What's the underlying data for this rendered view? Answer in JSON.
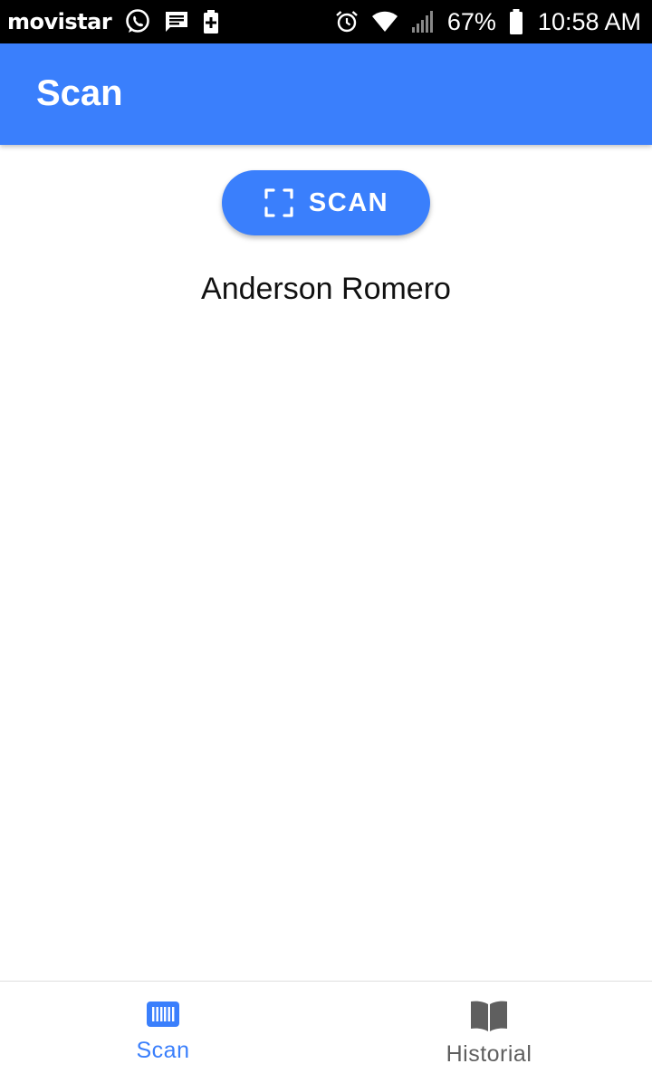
{
  "status_bar": {
    "carrier": "movistar",
    "battery_percent": "67%",
    "time": "10:58 AM",
    "icons": [
      "whatsapp-icon",
      "message-icon",
      "battery-saver-icon",
      "alarm-icon",
      "wifi-icon",
      "signal-icon",
      "battery-icon"
    ]
  },
  "app_bar": {
    "title": "Scan"
  },
  "main": {
    "scan_button_label": "SCAN",
    "scan_button_icon": "scan-frame-icon",
    "result_text": "Anderson Romero"
  },
  "bottom_nav": {
    "items": [
      {
        "label": "Scan",
        "icon": "barcode-icon",
        "active": true
      },
      {
        "label": "Historial",
        "icon": "book-icon",
        "active": false
      }
    ]
  },
  "colors": {
    "primary": "#3a7ffc",
    "status_bar": "#000000",
    "inactive": "#5f5f5f"
  }
}
